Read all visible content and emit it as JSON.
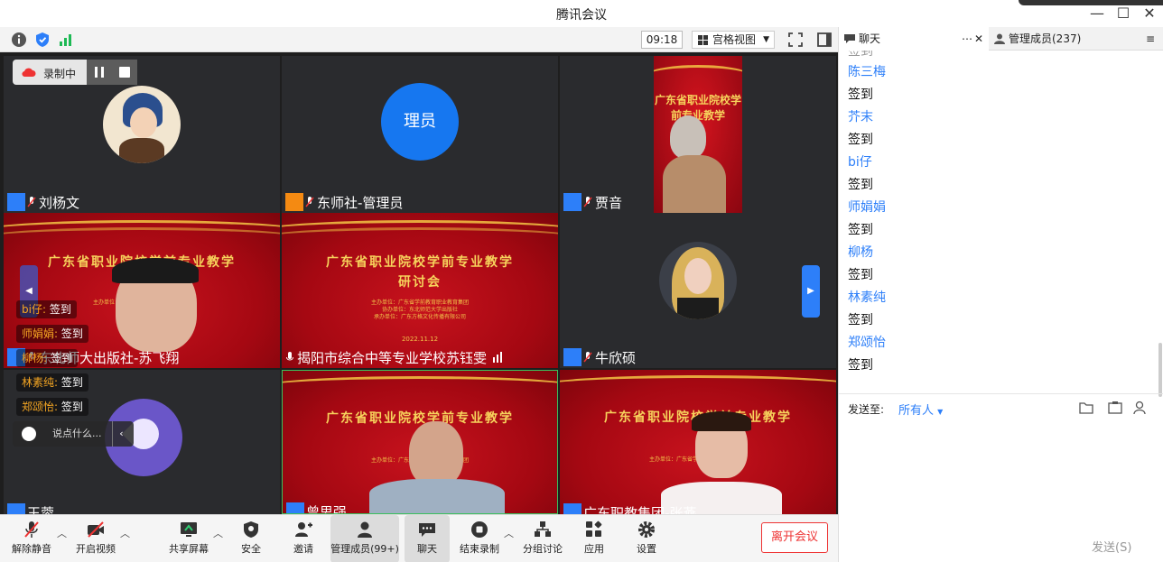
{
  "window": {
    "title": "腾讯会议",
    "minimize": "—",
    "maximize": "☐",
    "close": "✕"
  },
  "toolbar": {
    "time": "09:18",
    "view_mode": "宫格视图"
  },
  "recording": {
    "label": "录制中"
  },
  "tiles": [
    {
      "name": "刘杨文"
    },
    {
      "name": "东师社-管理员",
      "avatar_text": "理员"
    },
    {
      "name": "贾音"
    },
    {
      "name": "东北师大出版社-苏飞翔"
    },
    {
      "name": "揭阳市综合中等专业学校苏钰雯"
    },
    {
      "name": "牛欣硕"
    },
    {
      "name": "王蓉"
    },
    {
      "name": "曾思强"
    },
    {
      "name": "广东职教集团-张燕"
    }
  ],
  "slide": {
    "title_line1": "广东省职业院校学前专业教学",
    "title_line2": "研讨会",
    "date": "2022.11.12",
    "sponsors": [
      "主办单位：广东省学前教育职业教育集团",
      "协办单位：东北师范大学出版社",
      "承办单位：广东方格文化传播有限公司"
    ]
  },
  "danmu": [
    {
      "who": "bi仔:",
      "text": "签到"
    },
    {
      "who": "师娟娟:",
      "text": "签到"
    },
    {
      "who": "柳杨:",
      "text": "签到"
    },
    {
      "who": "林素纯:",
      "text": "签到"
    },
    {
      "who": "郑颂怡:",
      "text": "签到"
    }
  ],
  "say_placeholder": "说点什么...",
  "bottom_bar": {
    "mute": "解除静音",
    "video": "开启视频",
    "share": "共享屏幕",
    "security": "安全",
    "invite": "邀请",
    "members": "管理成员(99+)",
    "chat": "聊天",
    "end_record": "结束录制",
    "breakout": "分组讨论",
    "apps": "应用",
    "settings": "设置",
    "leave": "离开会议"
  },
  "chat": {
    "tab_chat": "聊天",
    "tab_members": "管理成员(237)",
    "messages": [
      {
        "name": "陈三梅",
        "text": "签到"
      },
      {
        "name": "芥末",
        "text": "签到"
      },
      {
        "name": "bi仔",
        "text": "签到"
      },
      {
        "name": "师娟娟",
        "text": "签到"
      },
      {
        "name": "柳杨",
        "text": "签到"
      },
      {
        "name": "林素纯",
        "text": "签到"
      },
      {
        "name": "郑颂怡",
        "text": "签到"
      }
    ],
    "send_to_label": "发送至:",
    "send_to_value": "所有人",
    "send_button": "发送(S)"
  },
  "colors": {
    "accent": "#2d7ff9",
    "leave": "#e33333",
    "slide_red": "#b30a14",
    "slide_gold": "#f7d35c"
  }
}
